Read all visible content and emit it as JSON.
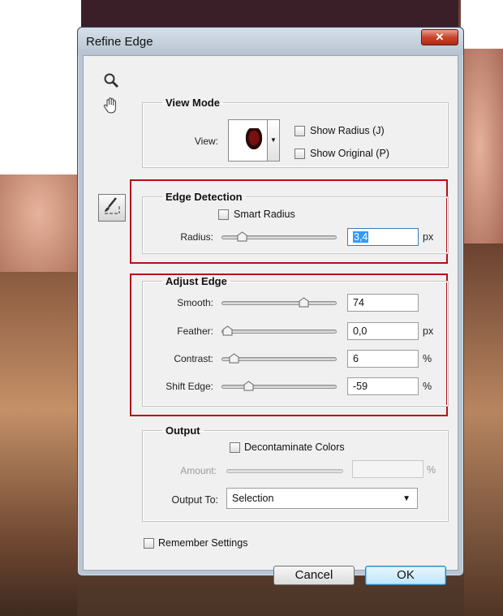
{
  "dialog": {
    "title": "Refine Edge",
    "close_glyph": "✕"
  },
  "tools": {
    "zoom_icon": "magnifier-icon",
    "hand_icon": "hand-icon",
    "brush_icon": "refine-radius-brush-icon"
  },
  "view_mode": {
    "legend": "View Mode",
    "view_label": "View:",
    "show_radius": {
      "label": "Show Radius (J)",
      "checked": false
    },
    "show_original": {
      "label": "Show Original (P)",
      "checked": false
    }
  },
  "edge_detection": {
    "legend": "Edge Detection",
    "smart_radius": {
      "label": "Smart Radius",
      "checked": false
    },
    "radius": {
      "label": "Radius:",
      "value": "3,4",
      "unit": "px",
      "slider_fraction": 0.14
    }
  },
  "adjust_edge": {
    "legend": "Adjust Edge",
    "smooth": {
      "label": "Smooth:",
      "value": "74",
      "unit": "",
      "slider_fraction": 0.74
    },
    "feather": {
      "label": "Feather:",
      "value": "0,0",
      "unit": "px",
      "slider_fraction": 0.0
    },
    "contrast": {
      "label": "Contrast:",
      "value": "6",
      "unit": "%",
      "slider_fraction": 0.06
    },
    "shift_edge": {
      "label": "Shift Edge:",
      "value": "-59",
      "unit": "%",
      "slider_fraction": 0.205
    }
  },
  "output": {
    "legend": "Output",
    "decontaminate": {
      "label": "Decontaminate Colors",
      "checked": false
    },
    "amount": {
      "label": "Amount:",
      "value": "",
      "unit": "%"
    },
    "output_to": {
      "label": "Output To:",
      "value": "Selection"
    }
  },
  "remember": {
    "label": "Remember Settings",
    "checked": false
  },
  "buttons": {
    "cancel": "Cancel",
    "ok": "OK"
  }
}
